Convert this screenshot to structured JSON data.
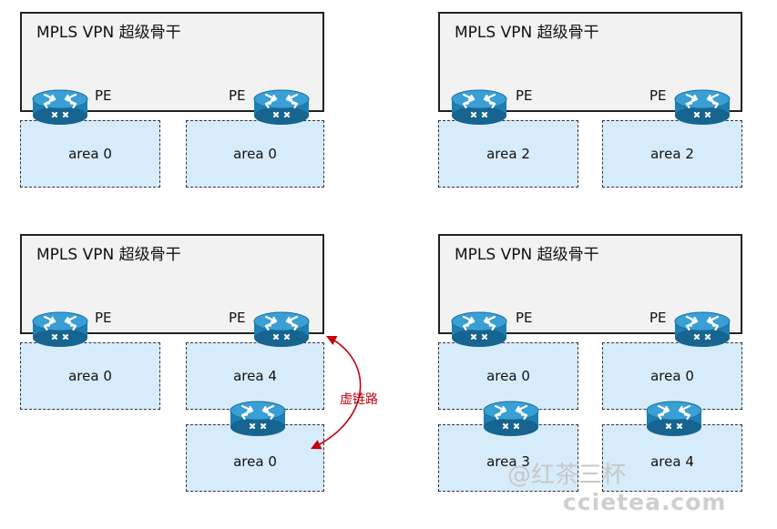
{
  "backbone_title": "MPLS VPN 超级骨干",
  "pe_label": "PE",
  "virtual_link_label": "虚链路",
  "panels": [
    {
      "areas": [
        "area 0",
        "area 0"
      ]
    },
    {
      "areas": [
        "area 2",
        "area 2"
      ]
    },
    {
      "areas": [
        "area 0",
        "area 4",
        "area 0"
      ]
    },
    {
      "areas": [
        "area 0",
        "area 0",
        "area 3",
        "area 4"
      ]
    }
  ],
  "watermark": {
    "line1": "@红茶三杯",
    "line2": "ccietea.com"
  },
  "colors": {
    "area_fill": "#d7ecfb",
    "backbone_fill": "#f2f2f2",
    "router": "#1e7fb3",
    "virtual_link": "#c2000f"
  },
  "icons": {
    "router": "router-icon"
  }
}
